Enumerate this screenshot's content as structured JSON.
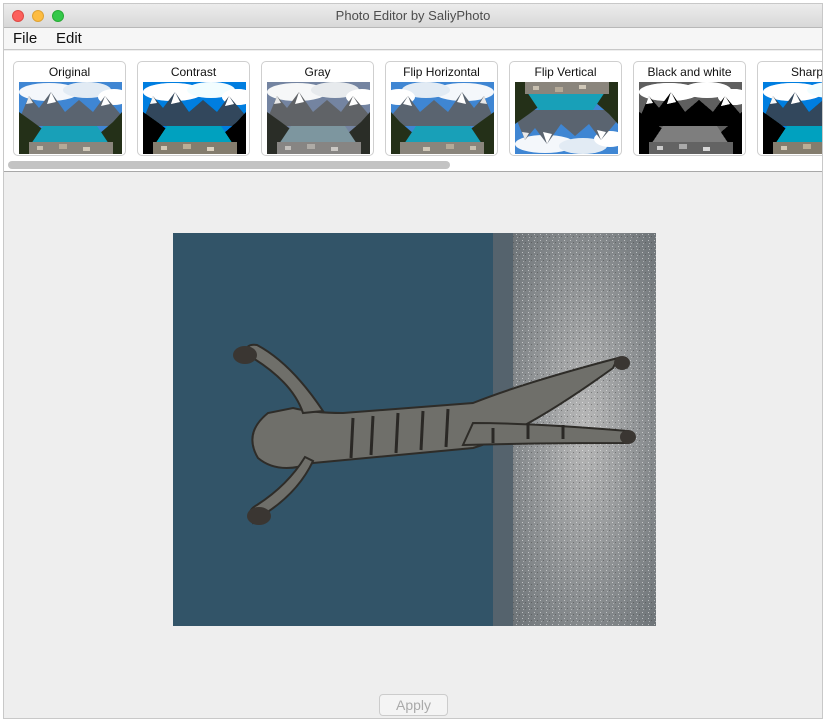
{
  "window": {
    "title": "Photo Editor by SaliyPhoto"
  },
  "menubar": {
    "file": "File",
    "edit": "Edit"
  },
  "filters": [
    {
      "label": "Original"
    },
    {
      "label": "Contrast"
    },
    {
      "label": "Gray"
    },
    {
      "label": "Flip Horizontal"
    },
    {
      "label": "Flip Vertical"
    },
    {
      "label": "Black and white"
    },
    {
      "label": "Sharp"
    }
  ],
  "actions": {
    "apply_label": "Apply"
  },
  "colors": {
    "window_bg": "#eeeeee",
    "lake": "#18a0b8",
    "sky": "#3f86d3",
    "wall": "#2f4f63",
    "floor": "#a8a8a8"
  }
}
